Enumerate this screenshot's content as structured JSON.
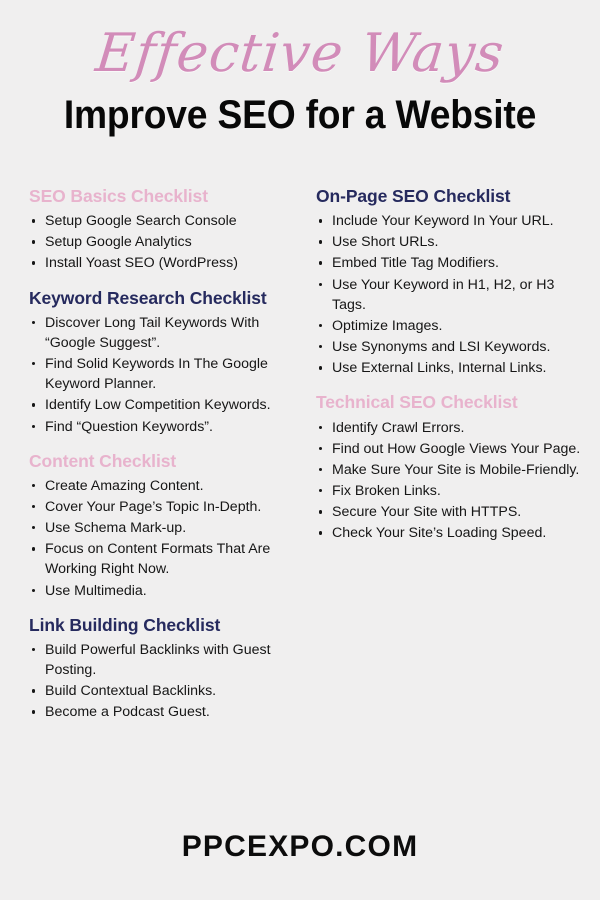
{
  "header": {
    "script_title": "Effective Ways",
    "main_title": "Improve SEO for a Website"
  },
  "columns": {
    "left": [
      {
        "title": "SEO Basics Checklist",
        "color": "pink",
        "items": [
          "Setup Google Search Console",
          "Setup Google Analytics",
          "Install Yoast SEO (WordPress)"
        ]
      },
      {
        "title": "Keyword Research Checklist",
        "color": "navy",
        "items": [
          "Discover Long Tail Keywords With “Google Suggest”.",
          "Find Solid Keywords In The Google Keyword Planner.",
          "Identify Low Competition Keywords.",
          "Find “Question Keywords”."
        ]
      },
      {
        "title": "Content Checklist",
        "color": "pink",
        "items": [
          "Create Amazing Content.",
          "Cover Your Page’s Topic In-Depth.",
          "Use Schema Mark-up.",
          "Focus on Content Formats That Are Working Right Now.",
          "Use Multimedia."
        ]
      },
      {
        "title": "Link Building Checklist",
        "color": "navy",
        "items": [
          "Build Powerful Backlinks with Guest Posting.",
          "Build Contextual Backlinks.",
          "Become a Podcast Guest."
        ]
      }
    ],
    "right": [
      {
        "title": "On-Page SEO Checklist",
        "color": "navy",
        "items": [
          "Include Your Keyword In Your URL.",
          "Use Short URLs.",
          "Embed Title Tag Modifiers.",
          "Use Your Keyword in H1, H2, or H3 Tags.",
          "Optimize Images.",
          "Use Synonyms and LSI Keywords.",
          "Use External Links, Internal Links."
        ]
      },
      {
        "title": "Technical SEO Checklist",
        "color": "pink",
        "items": [
          "Identify Crawl Errors.",
          "Find out How Google Views Your Page.",
          "Make Sure Your Site is Mobile-Friendly.",
          "Fix Broken Links.",
          "Secure Your Site with HTTPS.",
          "Check Your Site’s Loading Speed."
        ]
      }
    ]
  },
  "footer": {
    "brand": "PPCEXPO.COM"
  },
  "colors": {
    "background": "#f0efef",
    "script_pink": "#d28cb9",
    "heading_pink": "#e8b3cd",
    "heading_navy": "#262a5e",
    "body_text": "#161616",
    "brand_text": "#0c0c0c"
  }
}
